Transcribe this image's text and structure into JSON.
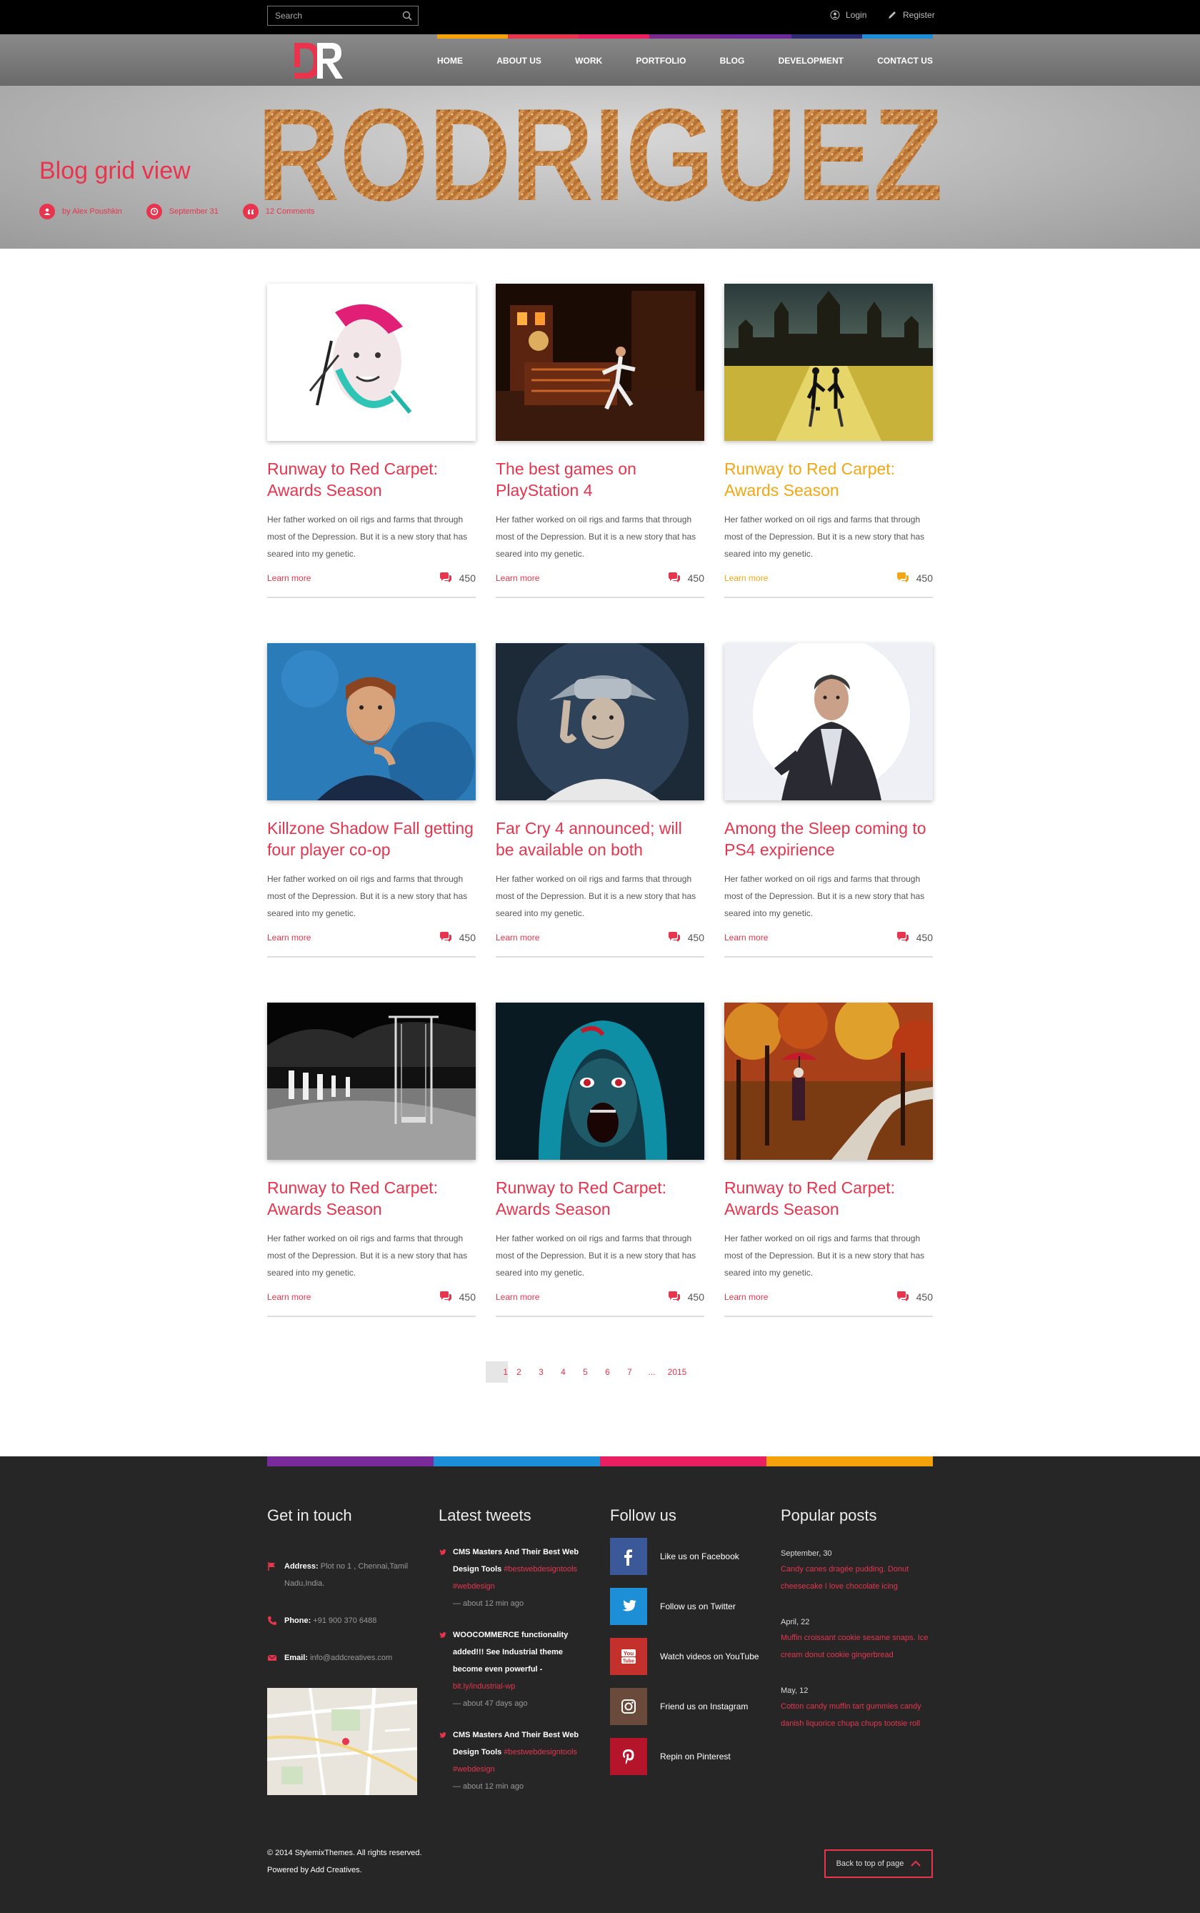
{
  "topbar": {
    "search_placeholder": "Search",
    "login_label": "Login",
    "register_label": "Register"
  },
  "nav": {
    "items": [
      "HOME",
      "ABOUT US",
      "WORK",
      "PORTFOLIO",
      "BLOG",
      "DEVELOPMENT",
      "CONTACT US"
    ],
    "stripe_colors": [
      "#f4a20b",
      "#e8344d",
      "#e91f62",
      "#7a2a8e",
      "#6a2a9b",
      "#2b2b73",
      "#1d8fd6"
    ]
  },
  "hero": {
    "brand_word": "RODRIGUEZ",
    "title": "Blog grid view",
    "author": "by Alex Poushkin",
    "date": "September 31",
    "comments": "12 Comments"
  },
  "posts": [
    {
      "title": "Runway to Red Carpet: Awards Season",
      "excerpt": "Her father worked on oil rigs and farms that through most of the Depression. But it is a new story that has seared into my genetic.",
      "learn_more": "Learn more",
      "comment_count": "450",
      "image": "watercolor-face"
    },
    {
      "title": "The best games on PlayStation 4",
      "excerpt": "Her father worked on oil rigs and farms that through most of the Depression. But it is a new story that has seared into my genetic.",
      "learn_more": "Learn more",
      "comment_count": "450",
      "image": "night-street-runner"
    },
    {
      "title": "Runway to Red Carpet: Awards Season",
      "excerpt": "Her father worked on oil rigs and farms that through most of the Depression. But it is a new story that has seared into my genetic.",
      "learn_more": "Learn more",
      "comment_count": "450",
      "image": "castle-couple"
    },
    {
      "title": "Killzone Shadow Fall getting four player co-op",
      "excerpt": "Her father worked on oil rigs and farms that through most of the Depression. But it is a new story that has seared into my genetic.",
      "learn_more": "Learn more",
      "comment_count": "450",
      "image": "bearded-man"
    },
    {
      "title": "Far Cry 4 announced; will be available on both",
      "excerpt": "Her father worked on oil rigs and farms that through most of the Depression. But it is a new story that has seared into my genetic.",
      "learn_more": "Learn more",
      "comment_count": "450",
      "image": "old-man-hat"
    },
    {
      "title": "Among the Sleep coming to PS4 expirience",
      "excerpt": "Her father worked on oil rigs and farms that through most of the Depression. But it is a new story that has seared into my genetic.",
      "learn_more": "Learn more",
      "comment_count": "450",
      "image": "man-in-jacket"
    },
    {
      "title": "Runway to Red Carpet: Awards Season",
      "excerpt": "Her father worked on oil rigs and farms that through most of the Depression. But it is a new story that has seared into my genetic.",
      "learn_more": "Learn more",
      "comment_count": "450",
      "image": "swing-bw"
    },
    {
      "title": "Runway to Red Carpet: Awards Season",
      "excerpt": "Her father worked on oil rigs and farms that through most of the Depression. But it is a new story that has seared into my genetic.",
      "learn_more": "Learn more",
      "comment_count": "450",
      "image": "screaming-face"
    },
    {
      "title": "Runway to Red Carpet: Awards Season",
      "excerpt": "Her father worked on oil rigs and farms that through most of the Depression. But it is a new story that has seared into my genetic.",
      "learn_more": "Learn more",
      "comment_count": "450",
      "image": "autumn-path"
    }
  ],
  "pagination": [
    "1",
    "2",
    "3",
    "4",
    "5",
    "6",
    "7",
    "...",
    "2015"
  ],
  "footer": {
    "stripe_colors": [
      "#7a2a9b",
      "#1d8fd6",
      "#e91f62",
      "#f4a20b"
    ],
    "get_in_touch": {
      "heading": "Get in touch",
      "address_label": "Address:",
      "address_value": "Plot no 1 , Chennai,Tamil Nadu,India.",
      "phone_label": "Phone:",
      "phone_value": "+91 900 370 6488",
      "email_label": "Email:",
      "email_value": "info@addcreatives.com"
    },
    "latest_tweets": {
      "heading": "Latest tweets",
      "tweets": [
        {
          "text": "CMS Masters And Their Best Web Design Tools",
          "tags": "#bestwebdesigntools #webdesign",
          "time": "— about 12 min ago"
        },
        {
          "text": "WOOCOMMERCE functionality added!!! See Industrial theme become even powerful -",
          "tags": "bit.ly/industrial-wp",
          "time": "— about 47 days ago"
        },
        {
          "text": "CMS Masters And Their Best Web Design Tools",
          "tags": "#bestwebdesigntools #webdesign",
          "time": "— about 12 min ago"
        }
      ]
    },
    "follow_us": {
      "heading": "Follow us",
      "items": [
        {
          "label": "Like us on Facebook",
          "color": "#3b5998",
          "icon": "facebook-icon"
        },
        {
          "label": "Follow us on Twitter",
          "color": "#1d8fd6",
          "icon": "twitter-icon"
        },
        {
          "label": "Watch videos on YouTube",
          "color": "#c4302b",
          "icon": "youtube-icon"
        },
        {
          "label": "Friend us on Instagram",
          "color": "#6a4a3a",
          "icon": "instagram-icon"
        },
        {
          "label": "Repin on Pinterest",
          "color": "#b5152b",
          "icon": "pinterest-icon"
        }
      ]
    },
    "popular_posts": {
      "heading": "Popular posts",
      "items": [
        {
          "date": "September, 30",
          "text": "Candy canes dragée pudding. Donut cheesecake I love chocolate icing"
        },
        {
          "date": "April, 22",
          "text": "Muffin croissant cookie sesame snaps. Ice cream donut cookie gingerbread"
        },
        {
          "date": "May, 12",
          "text": "Cotton candy muffin tart gummies candy danish liquorice chupa chups tootsie roll"
        }
      ]
    },
    "copyright_line1": "© 2014 StylemixThemes. All rights reserved.",
    "copyright_line2": "Powered by Add Creatives.",
    "back_to_top": "Back to top of page"
  },
  "colors": {
    "accent": "#e8344d",
    "yellow_accent": "#f3a713",
    "footer_bg": "#262626"
  }
}
